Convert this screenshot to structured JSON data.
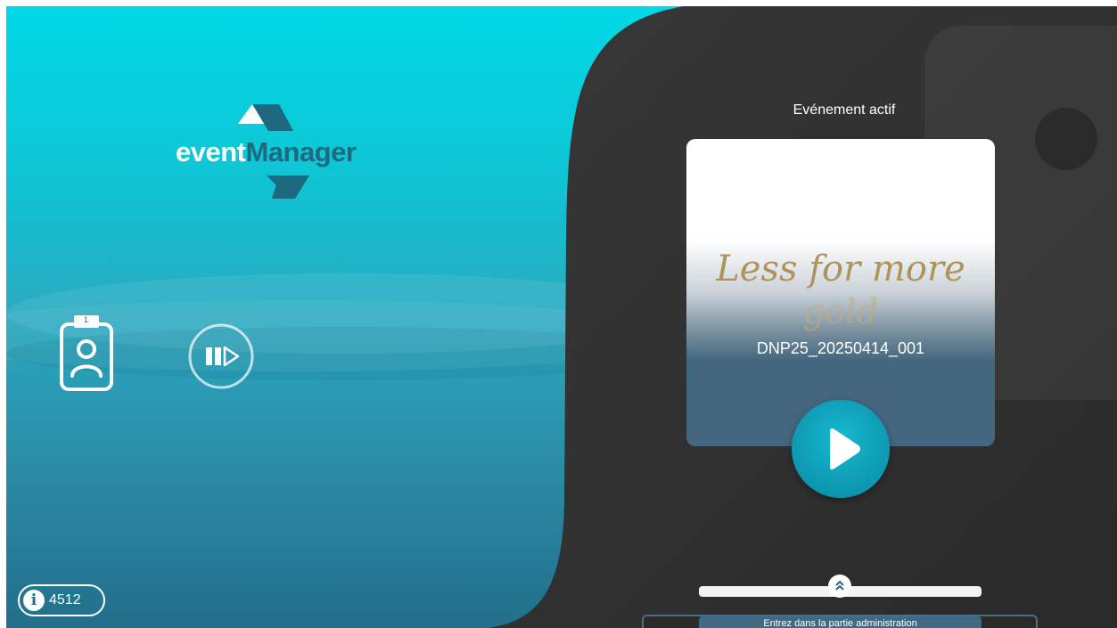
{
  "app": {
    "logo": {
      "word_event": "event",
      "word_manager": "Manager"
    }
  },
  "left_panel": {
    "badge_number": "1",
    "info": {
      "icon_glyph": "i",
      "value": "4512"
    }
  },
  "active_event": {
    "title": "Evénement actif",
    "card_script_line1": "Less for more",
    "card_script_line2": "gold",
    "code": "DNP25_20250414_001"
  },
  "admin": {
    "label": "Entrez dans la partie administration"
  },
  "colors": {
    "teal": "#00d9e6",
    "deep_teal": "#226f8a",
    "logo_dark": "#1d6a80",
    "dark_bg": "#2b2b2b",
    "start_button": "#0d97b0",
    "script_gold": "#b0935b"
  },
  "icons": [
    "badge-icon",
    "play-pause-icon",
    "info-icon",
    "play-icon",
    "chevron-double-up-icon"
  ]
}
